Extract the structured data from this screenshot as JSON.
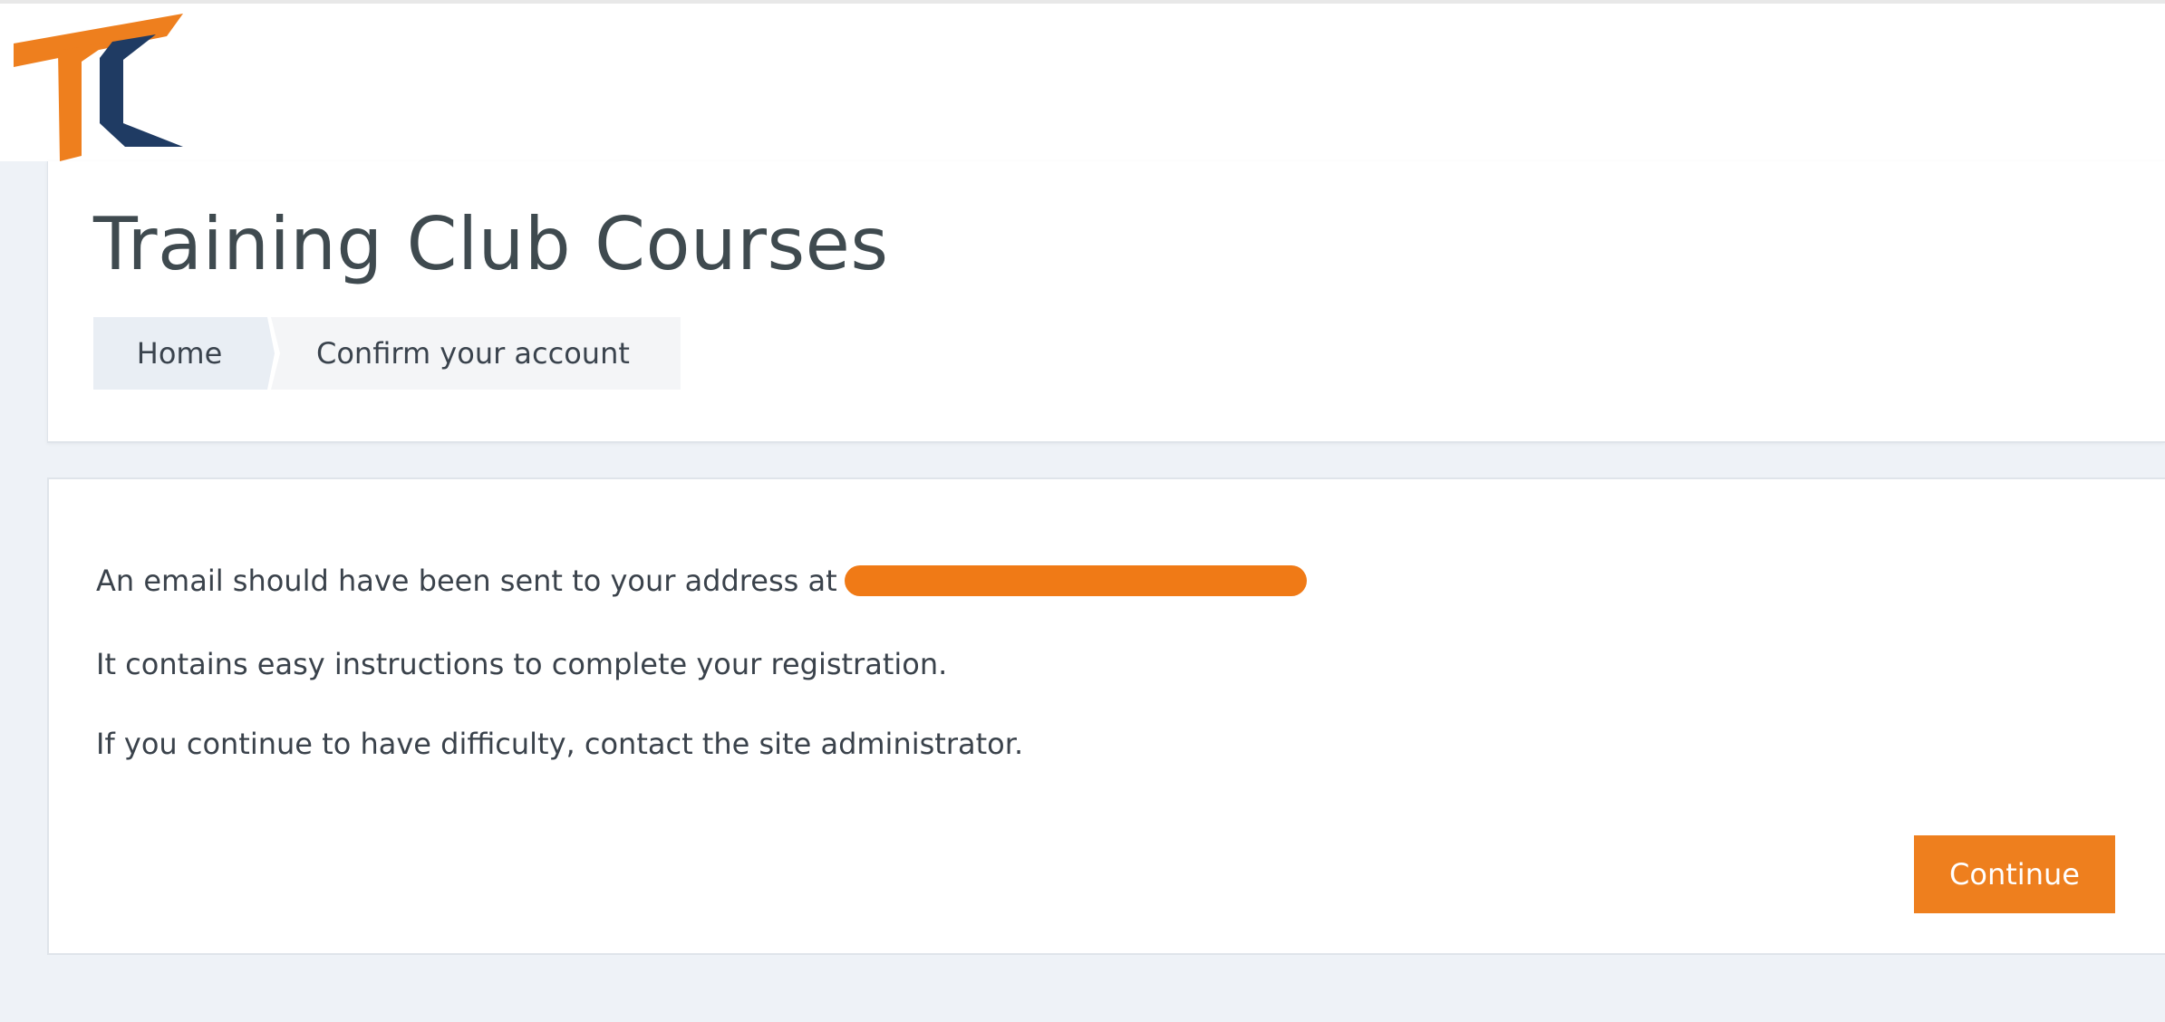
{
  "header": {
    "logo_icon": "tc-logo-icon",
    "brand_colors": {
      "orange": "#ee7f1e",
      "navy": "#1f3b63"
    }
  },
  "page": {
    "title": "Training Club Courses"
  },
  "breadcrumb": {
    "items": [
      {
        "label": "Home"
      },
      {
        "label": "Confirm your account"
      }
    ]
  },
  "message": {
    "line1": "An email should have been sent to your address at",
    "line2": "It contains easy instructions to complete your registration.",
    "line3": "If you continue to have difficulty, contact the site administrator."
  },
  "actions": {
    "continue_label": "Continue"
  }
}
